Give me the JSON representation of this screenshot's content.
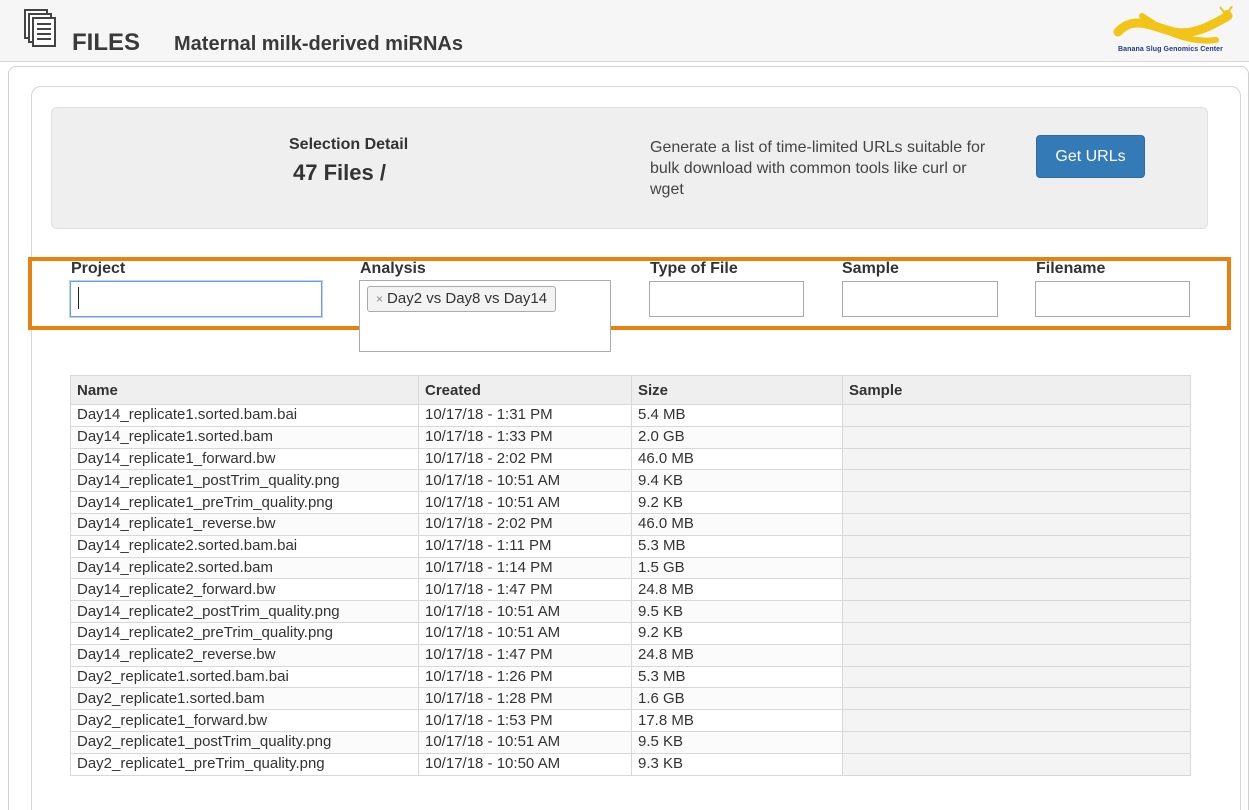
{
  "header": {
    "icon": "files-icon",
    "title": "FILES",
    "subtitle": "Maternal milk-derived miRNAs",
    "logo_text": "Banana Slug Genomics Center"
  },
  "selection": {
    "title": "Selection Detail",
    "count": "47 Files /",
    "description": "Generate a list of time-limited URLs suitable for bulk download with common tools like curl or wget",
    "button_label": "Get URLs"
  },
  "filters": {
    "project_label": "Project",
    "project_value": "",
    "analysis_label": "Analysis",
    "analysis_chip": "Day2 vs Day8 vs Day14",
    "analysis_chip_remove": "×",
    "type_label": "Type of File",
    "type_value": "",
    "sample_label": "Sample",
    "sample_value": "",
    "filename_label": "Filename",
    "filename_value": "",
    "highlight_color": "#e8820e"
  },
  "table": {
    "columns": [
      "Name",
      "Created",
      "Size",
      "Sample"
    ],
    "rows": [
      [
        "Day14_replicate1.sorted.bam.bai",
        "10/17/18 - 1:31 PM",
        "5.4 MB",
        ""
      ],
      [
        "Day14_replicate1.sorted.bam",
        "10/17/18 - 1:33 PM",
        "2.0 GB",
        ""
      ],
      [
        "Day14_replicate1_forward.bw",
        "10/17/18 - 2:02 PM",
        "46.0 MB",
        ""
      ],
      [
        "Day14_replicate1_postTrim_quality.png",
        "10/17/18 - 10:51 AM",
        "9.4 KB",
        ""
      ],
      [
        "Day14_replicate1_preTrim_quality.png",
        "10/17/18 - 10:51 AM",
        "9.2 KB",
        ""
      ],
      [
        "Day14_replicate1_reverse.bw",
        "10/17/18 - 2:02 PM",
        "46.0 MB",
        ""
      ],
      [
        "Day14_replicate2.sorted.bam.bai",
        "10/17/18 - 1:11 PM",
        "5.3 MB",
        ""
      ],
      [
        "Day14_replicate2.sorted.bam",
        "10/17/18 - 1:14 PM",
        "1.5 GB",
        ""
      ],
      [
        "Day14_replicate2_forward.bw",
        "10/17/18 - 1:47 PM",
        "24.8 MB",
        ""
      ],
      [
        "Day14_replicate2_postTrim_quality.png",
        "10/17/18 - 10:51 AM",
        "9.5 KB",
        ""
      ],
      [
        "Day14_replicate2_preTrim_quality.png",
        "10/17/18 - 10:51 AM",
        "9.2 KB",
        ""
      ],
      [
        "Day14_replicate2_reverse.bw",
        "10/17/18 - 1:47 PM",
        "24.8 MB",
        ""
      ],
      [
        "Day2_replicate1.sorted.bam.bai",
        "10/17/18 - 1:26 PM",
        "5.3 MB",
        ""
      ],
      [
        "Day2_replicate1.sorted.bam",
        "10/17/18 - 1:28 PM",
        "1.6 GB",
        ""
      ],
      [
        "Day2_replicate1_forward.bw",
        "10/17/18 - 1:53 PM",
        "17.8 MB",
        ""
      ],
      [
        "Day2_replicate1_postTrim_quality.png",
        "10/17/18 - 10:51 AM",
        "9.5 KB",
        ""
      ],
      [
        "Day2_replicate1_preTrim_quality.png",
        "10/17/18 - 10:50 AM",
        "9.3 KB",
        ""
      ]
    ]
  }
}
